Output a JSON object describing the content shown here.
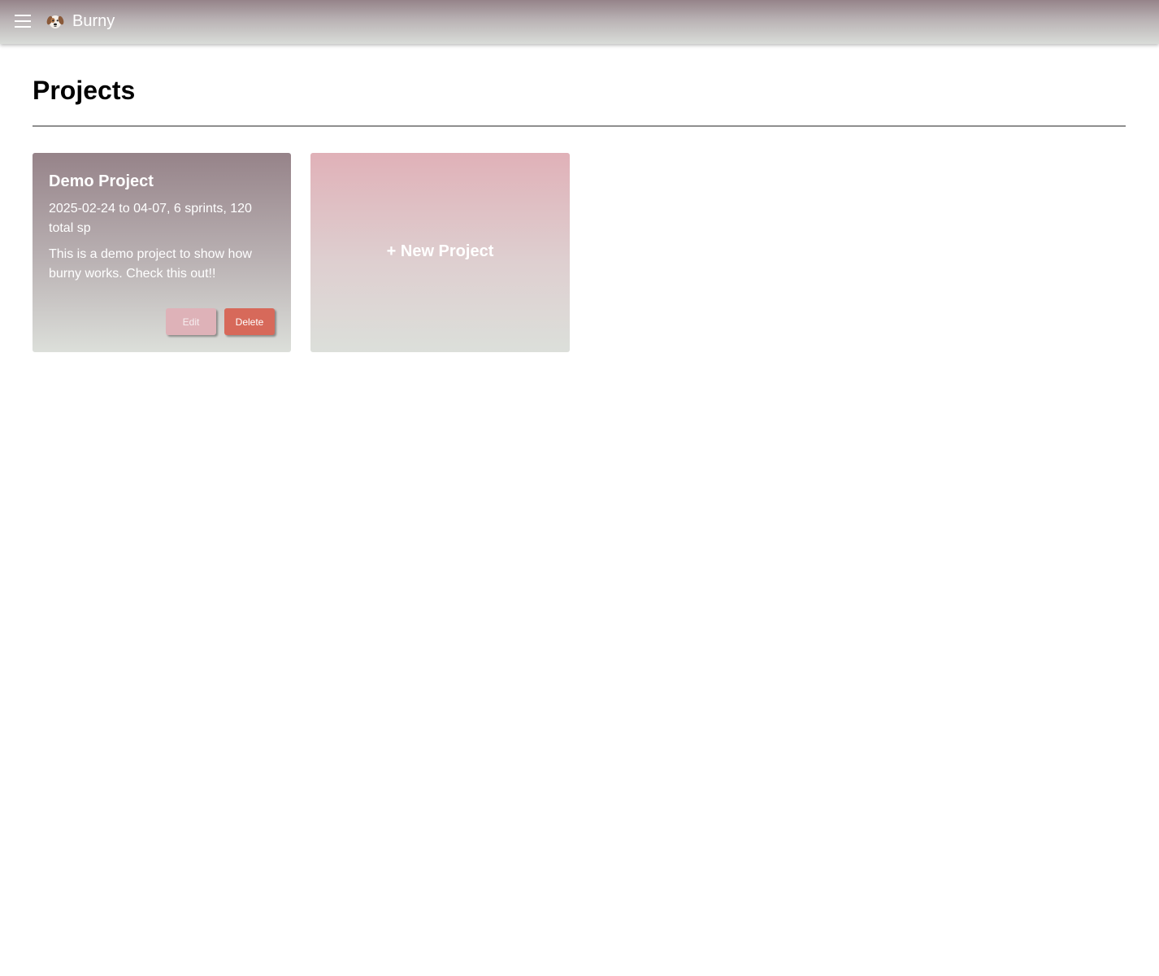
{
  "app": {
    "title": "Burny",
    "logo_icon": "dog-face-icon"
  },
  "header": {
    "menu_icon": "hamburger-menu-icon"
  },
  "main": {
    "page_title": "Projects",
    "projects": [
      {
        "name": "Demo Project",
        "meta": "2025-02-24 to 04-07, 6 sprints, 120 total sp",
        "description": "This is a demo project to show how burny works. Check this out!!",
        "edit_label": "Edit",
        "delete_label": "Delete"
      }
    ],
    "new_project_label": "+ New Project"
  },
  "colors": {
    "edit_button": "#deb2b8",
    "delete_button": "#d7695a",
    "divider": "#8f8f8f"
  }
}
